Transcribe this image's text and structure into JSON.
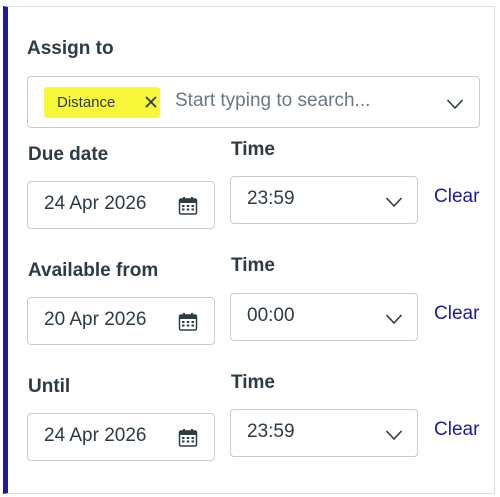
{
  "assign": {
    "label": "Assign to",
    "chip_label": "Distance",
    "placeholder": "Start typing to search..."
  },
  "rows": [
    {
      "date_label": "Due date",
      "date_value": "24 Apr 2026",
      "time_label": "Time",
      "time_value": "23:59",
      "clear_label": "Clear"
    },
    {
      "date_label": "Available from",
      "date_value": "20 Apr 2026",
      "time_label": "Time",
      "time_value": "00:00",
      "clear_label": "Clear"
    },
    {
      "date_label": "Until",
      "date_value": "24 Apr 2026",
      "time_label": "Time",
      "time_value": "23:59",
      "clear_label": "Clear"
    }
  ],
  "colors": {
    "accent": "#1d1b9c",
    "chip_highlight": "#f8f83a",
    "text": "#2d3b45",
    "border": "#c7cdd1"
  },
  "icons": {
    "chip_remove": "close-icon",
    "dropdown": "chevron-down-icon",
    "date_picker": "calendar-icon"
  }
}
